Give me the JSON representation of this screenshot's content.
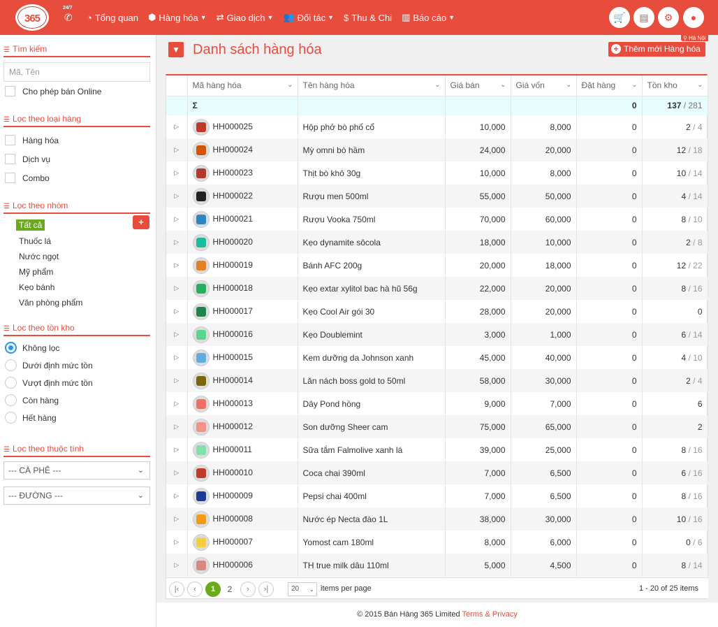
{
  "topbar": {
    "logo": "365",
    "hotline_badge": "24/7",
    "nav": [
      {
        "icon": "dashboard-icon",
        "label": "Tổng quan",
        "dropdown": false
      },
      {
        "icon": "cubes-icon",
        "label": "Hàng hóa",
        "dropdown": true
      },
      {
        "icon": "exchange-icon",
        "label": "Giao dịch",
        "dropdown": true
      },
      {
        "icon": "users-icon",
        "label": "Đối tác",
        "dropdown": true
      },
      {
        "icon": "dollar-icon",
        "label": "Thu & Chi",
        "dropdown": false
      },
      {
        "icon": "bar-chart-icon",
        "label": "Báo cáo",
        "dropdown": true
      }
    ],
    "accent": "#e74c3c"
  },
  "sidebar": {
    "search_title": "Tìm kiếm",
    "search_placeholder": "Mã, Tên",
    "online_label": "Cho phép bán Online",
    "type_title": "Lọc theo loại hàng",
    "types": [
      "Hàng hóa",
      "Dịch vụ",
      "Combo"
    ],
    "group_title": "Lọc theo nhóm",
    "groups": [
      "Tất cả",
      "Thuốc lá",
      "Nước ngọt",
      "Mỹ phẩm",
      "Kẹo bánh",
      "Văn phòng phẩm"
    ],
    "stock_title": "Lọc theo tồn kho",
    "stock_options": [
      "Không lọc",
      "Dưới định mức tồn",
      "Vượt định mức tồn",
      "Còn hàng",
      "Hết hàng"
    ],
    "attr_title": "Lọc theo thuộc tính",
    "attr_selects": [
      "--- CÀ PHÊ ---",
      "--- ĐƯỜNG ---"
    ]
  },
  "header": {
    "title": "Danh sách hàng hóa",
    "add_button": "Thêm mới Hàng hóa",
    "location": "Hà Nội"
  },
  "table": {
    "columns": [
      "Mã hàng hóa",
      "Tên hàng hóa",
      "Giá bán",
      "Giá vốn",
      "Đặt hàng",
      "Tồn kho"
    ],
    "sum": {
      "label": "Σ",
      "ordered": "0",
      "stock": "137",
      "stock_max": "/ 281"
    },
    "rows": [
      {
        "code": "HH000025",
        "name": "Hộp phở bò phố cổ",
        "price": "10,000",
        "cost": "8,000",
        "ordered": "0",
        "stock": "2",
        "max": "/ 4",
        "color": "#c0392b"
      },
      {
        "code": "HH000024",
        "name": "Mỳ omni bò hầm",
        "price": "24,000",
        "cost": "20,000",
        "ordered": "0",
        "stock": "12",
        "max": "/ 18",
        "color": "#d35400"
      },
      {
        "code": "HH000023",
        "name": "Thịt bò khô 30g",
        "price": "10,000",
        "cost": "8,000",
        "ordered": "0",
        "stock": "10",
        "max": "/ 14",
        "color": "#b03a2e"
      },
      {
        "code": "HH000022",
        "name": "Rượu men 500ml",
        "price": "55,000",
        "cost": "50,000",
        "ordered": "0",
        "stock": "4",
        "max": "/ 14",
        "color": "#222222"
      },
      {
        "code": "HH000021",
        "name": "Rượu Vooka 750ml",
        "price": "70,000",
        "cost": "60,000",
        "ordered": "0",
        "stock": "8",
        "max": "/ 10",
        "color": "#2e86c1"
      },
      {
        "code": "HH000020",
        "name": "Kẹo dynamite sôcola",
        "price": "18,000",
        "cost": "10,000",
        "ordered": "0",
        "stock": "2",
        "max": "/ 8",
        "color": "#1abc9c"
      },
      {
        "code": "HH000019",
        "name": "Bánh AFC 200g",
        "price": "20,000",
        "cost": "18,000",
        "ordered": "0",
        "stock": "12",
        "max": "/ 22",
        "color": "#e67e22"
      },
      {
        "code": "HH000018",
        "name": "Kẹo extar xylitol bac hà hũ 56g",
        "price": "22,000",
        "cost": "20,000",
        "ordered": "0",
        "stock": "8",
        "max": "/ 16",
        "color": "#27ae60"
      },
      {
        "code": "HH000017",
        "name": "Kẹo Cool Air gói 30",
        "price": "28,000",
        "cost": "20,000",
        "ordered": "0",
        "stock": "0",
        "max": "",
        "color": "#1e8449"
      },
      {
        "code": "HH000016",
        "name": "Kẹo Doublemint",
        "price": "3,000",
        "cost": "1,000",
        "ordered": "0",
        "stock": "6",
        "max": "/ 14",
        "color": "#58d68d"
      },
      {
        "code": "HH000015",
        "name": "Kem dưỡng da Johnson xanh",
        "price": "45,000",
        "cost": "40,000",
        "ordered": "0",
        "stock": "4",
        "max": "/ 10",
        "color": "#5dade2"
      },
      {
        "code": "HH000014",
        "name": "Lăn nách boss gold to 50ml",
        "price": "58,000",
        "cost": "30,000",
        "ordered": "0",
        "stock": "2",
        "max": "/ 4",
        "color": "#7d6608"
      },
      {
        "code": "HH000013",
        "name": "Dây Pond hồng",
        "price": "9,000",
        "cost": "7,000",
        "ordered": "0",
        "stock": "6",
        "max": "",
        "color": "#ec7063"
      },
      {
        "code": "HH000012",
        "name": "Son dưỡng Sheer cam",
        "price": "75,000",
        "cost": "65,000",
        "ordered": "0",
        "stock": "2",
        "max": "",
        "color": "#f1948a"
      },
      {
        "code": "HH000011",
        "name": "Sữa tắm Falmolive xanh lá",
        "price": "39,000",
        "cost": "25,000",
        "ordered": "0",
        "stock": "8",
        "max": "/ 16",
        "color": "#82e0aa"
      },
      {
        "code": "HH000010",
        "name": "Coca chai 390ml",
        "price": "7,000",
        "cost": "6,500",
        "ordered": "0",
        "stock": "6",
        "max": "/ 16",
        "color": "#c0392b"
      },
      {
        "code": "HH000009",
        "name": "Pepsi chai 400ml",
        "price": "7,000",
        "cost": "6,500",
        "ordered": "0",
        "stock": "8",
        "max": "/ 16",
        "color": "#1f3a93"
      },
      {
        "code": "HH000008",
        "name": "Nước ép Necta đào 1L",
        "price": "38,000",
        "cost": "30,000",
        "ordered": "0",
        "stock": "10",
        "max": "/ 16",
        "color": "#f39c12"
      },
      {
        "code": "HH000007",
        "name": "Yomost cam 180ml",
        "price": "8,000",
        "cost": "6,000",
        "ordered": "0",
        "stock": "0",
        "max": "/ 6",
        "color": "#f4d03f"
      },
      {
        "code": "HH000006",
        "name": "TH true milk dâu 110ml",
        "price": "5,000",
        "cost": "4,500",
        "ordered": "0",
        "stock": "8",
        "max": "/ 14",
        "color": "#d98880"
      }
    ]
  },
  "pager": {
    "pages": [
      "1",
      "2"
    ],
    "page_size": "20",
    "items_per_page": "items per page",
    "info": "1 - 20 of 25 items"
  },
  "footer": {
    "text": "© 2015 Bán Hàng 365 Limited",
    "link": "Terms & Privacy"
  }
}
